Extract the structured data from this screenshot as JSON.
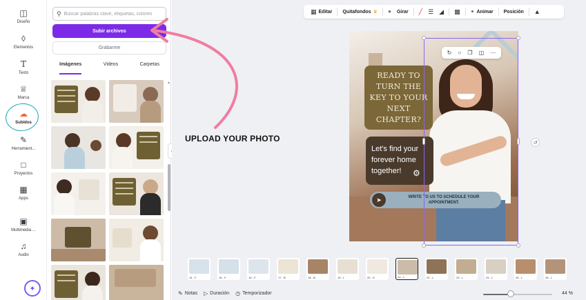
{
  "rail": {
    "items": [
      {
        "label": "Diseño",
        "icon": "layout-icon"
      },
      {
        "label": "Elementos",
        "icon": "shapes-icon"
      },
      {
        "label": "Texto",
        "icon": "text-icon"
      },
      {
        "label": "Marca",
        "icon": "brand-icon"
      },
      {
        "label": "Subidos",
        "icon": "cloud-upload-icon"
      },
      {
        "label": "Herramient...",
        "icon": "tools-icon"
      },
      {
        "label": "Proyectos",
        "icon": "folder-icon"
      },
      {
        "label": "Apps",
        "icon": "apps-icon"
      },
      {
        "label": "Multimedia ...",
        "icon": "multimedia-icon"
      },
      {
        "label": "Audio",
        "icon": "music-icon"
      }
    ],
    "active_label": "Subidos"
  },
  "panel": {
    "search_placeholder": "Buscar palabras clave, etiquetas, colores",
    "upload_label": "Subir archivos",
    "record_label": "Grabarme",
    "tabs": [
      "Imágenes",
      "Videos",
      "Carpetas"
    ],
    "active_tab": "Imágenes"
  },
  "toolbar": {
    "edit": "Editar",
    "remove_bg": "Quitafondos",
    "flip": "Girar",
    "animate": "Animar",
    "position": "Posición"
  },
  "design": {
    "card_title": "READY TO TURN THE KEY TO YOUR NEXT CHAPTER?",
    "card_body_lines": [
      "Let's find your",
      "forever home",
      "together!"
    ],
    "cta": "WRITE TO US TO SCHEDULE YOUR APPOINTMENT."
  },
  "annotation": {
    "text": "UPLOAD YOUR PHOTO",
    "color": "#f07da0",
    "circle_color": "#1aa6b5"
  },
  "timeline": {
    "frames": [
      {
        "label": "14 - F",
        "color": "#d8e2ea"
      },
      {
        "label": "15 - F",
        "color": "#d5e0e9"
      },
      {
        "label": "16 - F",
        "color": "#dce5ec"
      },
      {
        "label": "17 - B",
        "color": "#ece4d4"
      },
      {
        "label": "18 - B",
        "color": "#a88467"
      },
      {
        "label": "19 - L",
        "color": "#e7dfd3"
      },
      {
        "label": "20 - S",
        "color": "#efe9e2"
      },
      {
        "label": "21 - L",
        "color": "#cbbba8"
      },
      {
        "label": "22 - L",
        "color": "#8d7357"
      },
      {
        "label": "23 - L",
        "color": "#c2ad92"
      },
      {
        "label": "24 - L",
        "color": "#d9cfc3"
      },
      {
        "label": "25 - L",
        "color": "#b78f6e"
      },
      {
        "label": "26 - L",
        "color": "#b49478"
      }
    ],
    "selected_index": 7
  },
  "status": {
    "notes": "Notas",
    "duration": "Duración",
    "timer": "Temporizador",
    "zoom": "44 %",
    "zoom_level": 0.44
  },
  "colors": {
    "accent": "#7d2ae8",
    "selection": "#8d63f5",
    "card_olive": "#7b6738",
    "card_brown": "#4a3a2c"
  }
}
